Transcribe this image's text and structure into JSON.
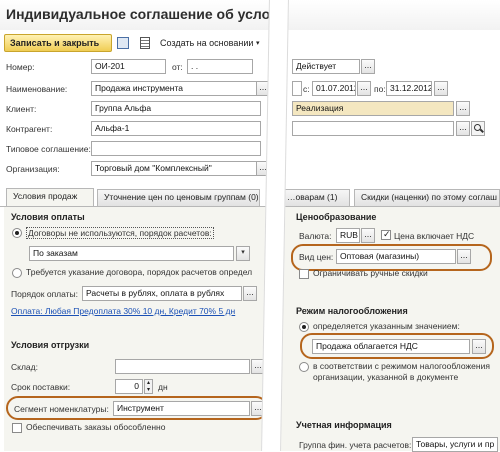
{
  "window": {
    "title": "Индивидуальное соглашение об услов"
  },
  "toolbar": {
    "save_close": "Записать и закрыть",
    "create_based": "Создать на основании"
  },
  "form": {
    "number_label": "Номер:",
    "number_value": "ОИ-201",
    "from_label": "от:",
    "date_value": ". .",
    "status_value": "Действует",
    "name_label": "Наименование:",
    "name_value": "Продажа инструмента",
    "period_from_label": "с:",
    "period_from": "01.07.2012",
    "period_to_label": "по:",
    "period_to": "31.12.2012",
    "client_label": "Клиент:",
    "client_value": "Группа Альфа",
    "operation_value": "Реализация",
    "counterparty_label": "Контрагент:",
    "counterparty_value": "Альфа-1",
    "template_label": "Типовое соглашение:",
    "org_label": "Организация:",
    "org_value": "Торговый дом \"Комплексный\""
  },
  "tabs": [
    {
      "label": "Условия продаж"
    },
    {
      "label": "Уточнение цен по ценовым группам (0)"
    },
    {
      "label": "…оварам (1)"
    },
    {
      "label": "Скидки (наценки) по этому соглаш"
    }
  ],
  "left": {
    "payment_title": "Условия оплаты",
    "radio1": "Договоры не используются, порядок расчетов:",
    "orders_value": "По заказам",
    "radio2": "Требуется указание договора, порядок расчетов определ",
    "payment_order_label": "Порядок оплаты:",
    "payment_order_value": "Расчеты в рублях, оплата в рублях",
    "payment_link": "Оплата: Любая Предоплата 30% 10 дн, Кредит 70% 5 дн",
    "shipping_title": "Условия отгрузки",
    "warehouse_label": "Склад:",
    "delivery_label": "Срок поставки:",
    "delivery_value": "0",
    "delivery_unit": "дн",
    "segment_label": "Сегмент номенклатуры:",
    "segment_value": "Инструмент",
    "separate_orders": "Обеспечивать заказы обособленно"
  },
  "right": {
    "pricing_title": "Ценообразование",
    "currency_label": "Валюта:",
    "currency_value": "RUB",
    "vat_included": "Цена включает НДС",
    "price_type_label": "Вид цен:",
    "price_type_value": "Оптовая (магазины)",
    "limit_discounts": "Ограничивать ручные скидки",
    "tax_title": "Режим налогообложения",
    "tax_radio1": "определяется указанным значением:",
    "tax_value": "Продажа облагается НДС",
    "tax_radio2_line1": "в соответствии с режимом налогообложения",
    "tax_radio2_line2": "организации, указанной в документе",
    "accounting_title": "Учетная информация",
    "accounting_label": "Группа фин. учета расчетов:",
    "accounting_value": "Товары, услуги и пр"
  },
  "colors": {
    "accent_outline": "#b5651d",
    "link": "#1a50b5",
    "operation_bg": "#f4e7c0"
  }
}
